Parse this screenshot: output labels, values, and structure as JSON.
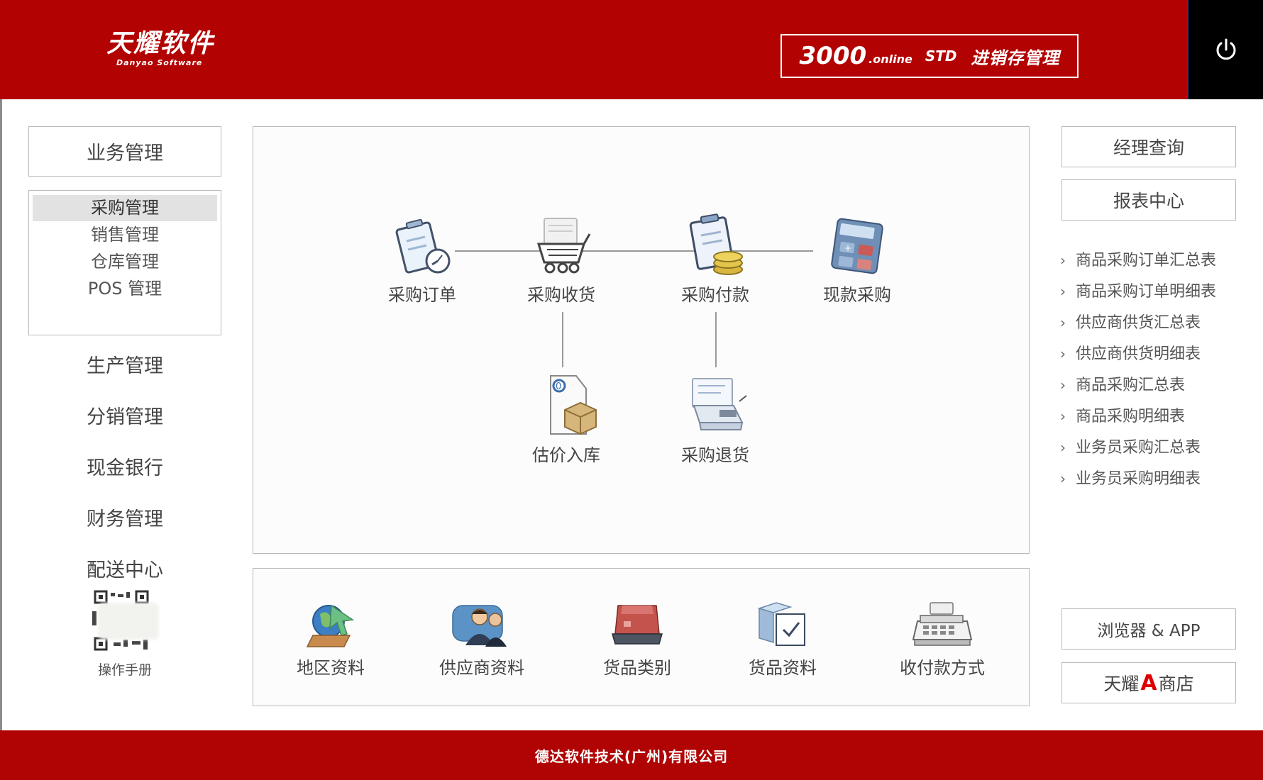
{
  "header": {
    "logo_main": "天耀软件",
    "logo_sub": "Danyao Software",
    "product_number": "3000",
    "product_online": ".online",
    "product_std": "STD",
    "product_name": "进销存管理",
    "power_icon": "power-icon"
  },
  "left": {
    "business_button": "业务管理",
    "submenu": [
      {
        "label": "采购管理",
        "active": true
      },
      {
        "label": "销售管理",
        "active": false
      },
      {
        "label": "仓库管理",
        "active": false
      },
      {
        "label": "POS 管理",
        "active": false
      }
    ],
    "sections": [
      "生产管理",
      "分销管理",
      "现金银行",
      "财务管理",
      "配送中心"
    ],
    "manual": "操作手册"
  },
  "flow": {
    "nodes": [
      {
        "label": "采购订单",
        "icon": "purchase-order-icon"
      },
      {
        "label": "采购收货",
        "icon": "purchase-receipt-icon"
      },
      {
        "label": "采购付款",
        "icon": "purchase-payment-icon"
      },
      {
        "label": "现款采购",
        "icon": "cash-purchase-icon"
      },
      {
        "label": "估价入库",
        "icon": "estimate-stock-in-icon"
      },
      {
        "label": "采购退货",
        "icon": "purchase-return-icon"
      }
    ]
  },
  "tools": [
    {
      "label": "地区资料",
      "icon": "region-icon"
    },
    {
      "label": "供应商资料",
      "icon": "supplier-icon"
    },
    {
      "label": "货品类别",
      "icon": "goods-category-icon"
    },
    {
      "label": "货品资料",
      "icon": "goods-info-icon"
    },
    {
      "label": "收付款方式",
      "icon": "payment-method-icon"
    }
  ],
  "right": {
    "manager_query": "经理查询",
    "report_center": "报表中心",
    "reports": [
      "商品采购订单汇总表",
      "商品采购订单明细表",
      "供应商供货汇总表",
      "供应商供货明细表",
      "商品采购汇总表",
      "商品采购明细表",
      "业务员采购汇总表",
      "业务员采购明细表"
    ],
    "browser_app": "浏览器 & APP",
    "store_prefix": "天耀",
    "store_a": "A",
    "store_suffix": "商店"
  },
  "footer": {
    "company": "德达软件技术(广州)有限公司"
  },
  "colors": {
    "brand_red": "#b30202",
    "footer_red": "#b00404",
    "power_bg": "#000000",
    "border_gray": "#b9b9b9"
  }
}
